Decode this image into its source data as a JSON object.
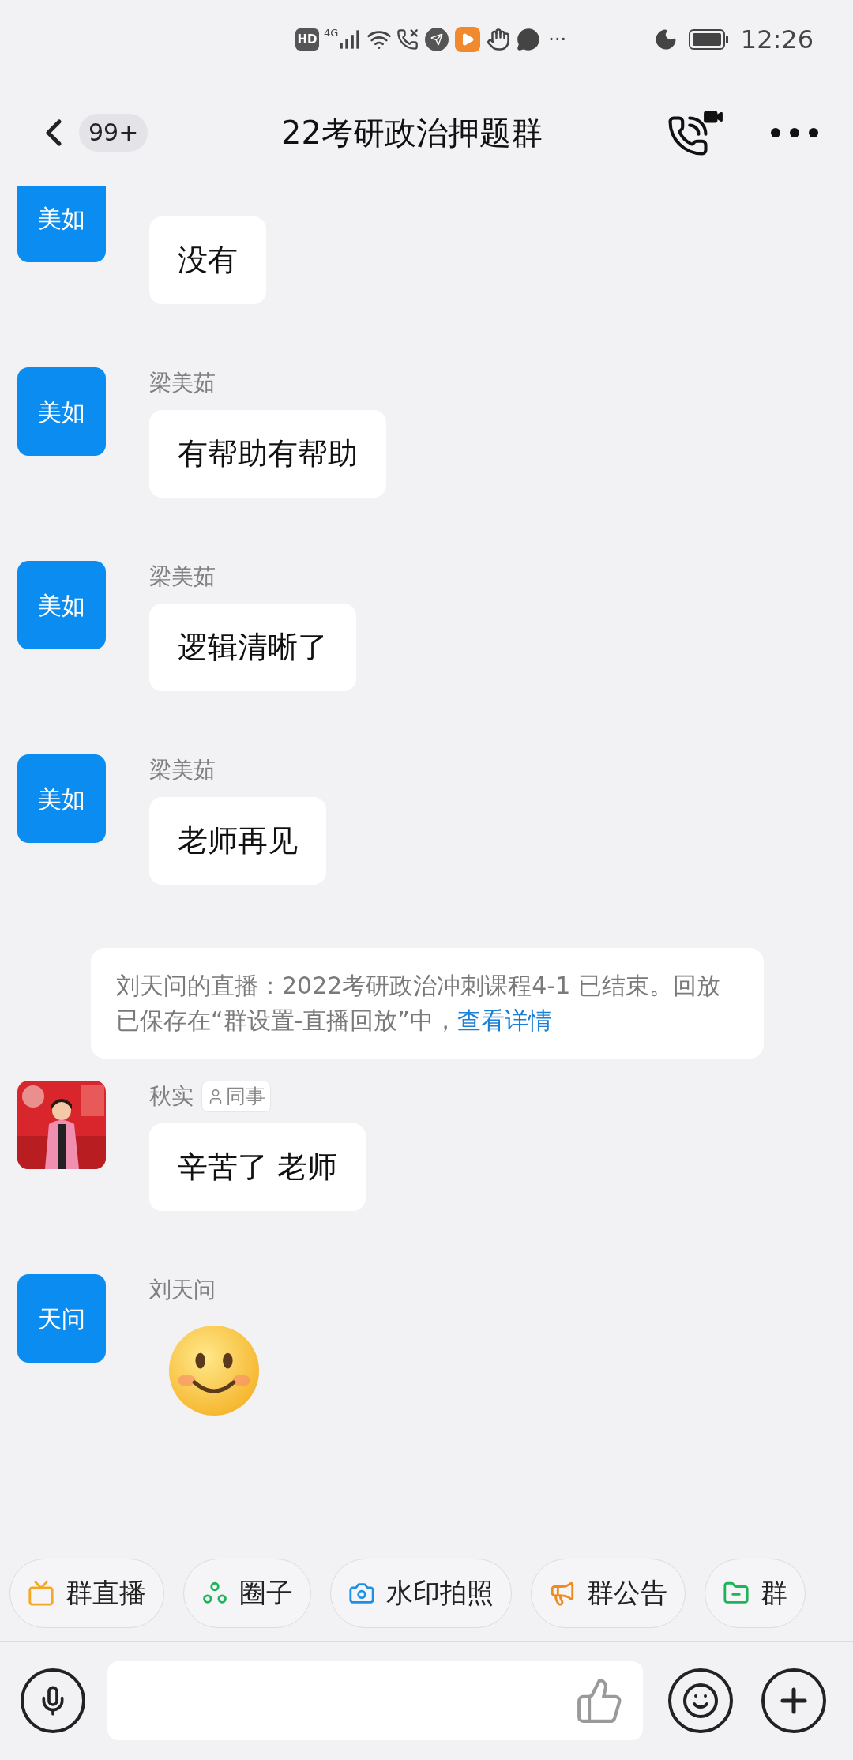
{
  "status_bar": {
    "hd": "HD",
    "network": "4G",
    "more": "···",
    "time": "12:26"
  },
  "header": {
    "unread": "99+",
    "title": "22考研政治押题群"
  },
  "messages": [
    {
      "kind": "text",
      "avatar": {
        "kind": "initials",
        "text": "美如"
      },
      "text": "没有"
    },
    {
      "kind": "text",
      "avatar": {
        "kind": "initials",
        "text": "美如"
      },
      "sender": "梁美茹",
      "text": "有帮助有帮助"
    },
    {
      "kind": "text",
      "avatar": {
        "kind": "initials",
        "text": "美如"
      },
      "sender": "梁美茹",
      "text": "逻辑清晰了"
    },
    {
      "kind": "text",
      "avatar": {
        "kind": "initials",
        "text": "美如"
      },
      "sender": "梁美茹",
      "text": "老师再见"
    },
    {
      "kind": "notice",
      "text": "刘天问的直播：2022考研政治冲刺课程4-1 已结束。回放已保存在“群设置-直播回放”中，",
      "link": "查看详情"
    },
    {
      "kind": "text",
      "sender": "秋实",
      "tag": "同事",
      "text": "辛苦了 老师"
    },
    {
      "kind": "sticker",
      "avatar": {
        "kind": "initials",
        "text": "天问"
      },
      "sender": "刘天问"
    }
  ],
  "shortcuts": [
    {
      "label": "群直播"
    },
    {
      "label": "圈子"
    },
    {
      "label": "水印拍照"
    },
    {
      "label": "群公告"
    },
    {
      "label": "群"
    }
  ]
}
